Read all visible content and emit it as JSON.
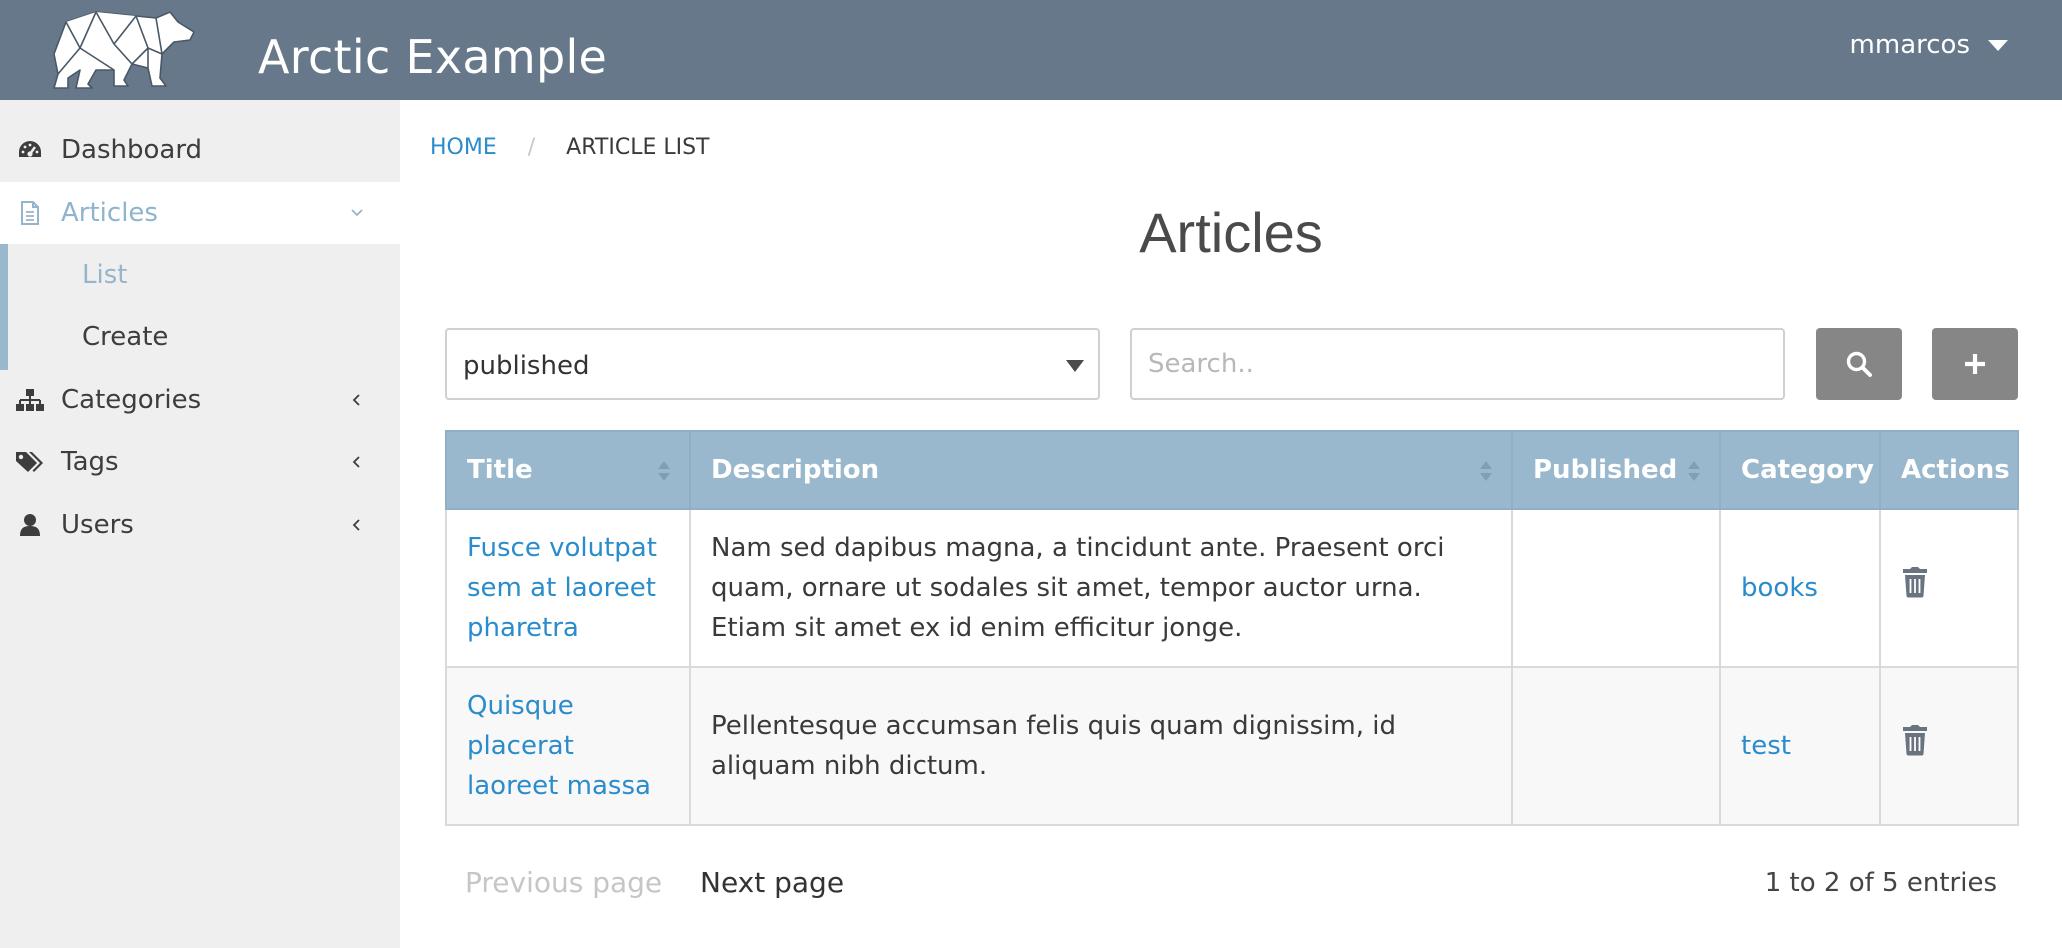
{
  "header": {
    "app_title": "Arctic Example",
    "user_name": "mmarcos",
    "bg_color": "#667889"
  },
  "sidebar": {
    "items": [
      {
        "label": "Dashboard",
        "icon": "dashboard-icon"
      },
      {
        "label": "Articles",
        "icon": "document-icon",
        "expanded": true
      },
      {
        "label": "Categories",
        "icon": "sitemap-icon"
      },
      {
        "label": "Tags",
        "icon": "tags-icon"
      },
      {
        "label": "Users",
        "icon": "user-icon"
      }
    ],
    "articles_sub": [
      {
        "label": "List",
        "current": true
      },
      {
        "label": "Create"
      }
    ],
    "accent_color": "#9ab8cd"
  },
  "breadcrumb": {
    "home": "HOME",
    "separator": "/",
    "current": "ARTICLE LIST"
  },
  "page": {
    "title": "Articles"
  },
  "filters": {
    "status_value": "published",
    "search_placeholder": "Search..",
    "search_value": ""
  },
  "table": {
    "headers": {
      "title": "Title",
      "description": "Description",
      "published": "Published",
      "category": "Category",
      "actions": "Actions"
    },
    "header_color": "#9ab8cd",
    "rows": [
      {
        "title": "Fusce volutpat sem at laoreet pharetra",
        "description": "Nam sed dapibus magna, a tincidunt ante. Praesent orci quam, ornare ut sodales sit amet, tempor auctor urna. Etiam sit amet ex id enim efficitur jonge.",
        "published": "",
        "category": "books"
      },
      {
        "title": "Quisque placerat laoreet massa",
        "description": "Pellentesque accumsan felis quis quam dignissim, id aliquam nibh dictum.",
        "published": "",
        "category": "test"
      }
    ]
  },
  "pagination": {
    "previous": "Previous page",
    "next": "Next page",
    "info": "1 to 2 of 5 entries"
  }
}
